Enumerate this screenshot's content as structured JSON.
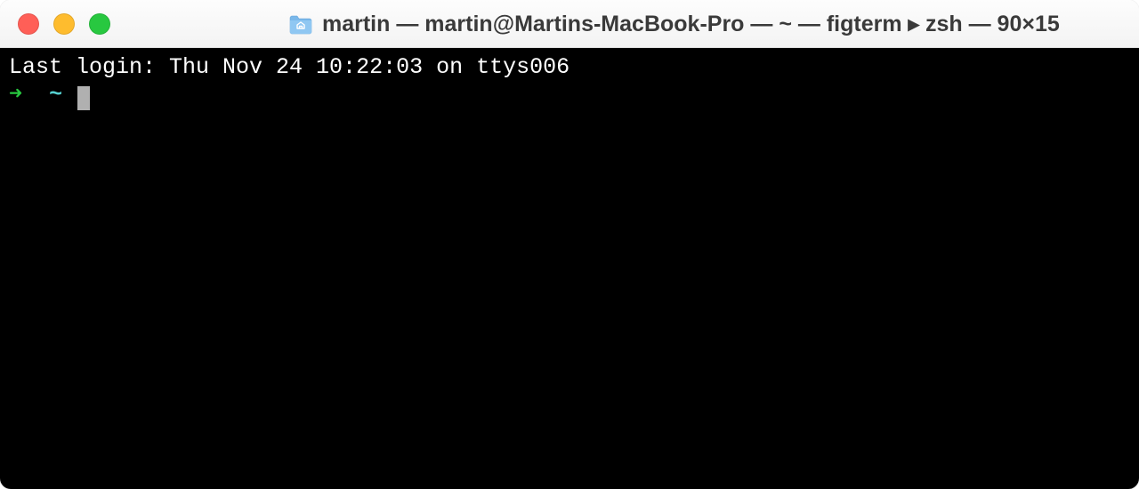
{
  "titlebar": {
    "title": "martin — martin@Martins-MacBook-Pro — ~ — figterm ▸ zsh — 90×15",
    "folder_icon": "home-folder-icon"
  },
  "terminal": {
    "last_login": "Last login: Thu Nov 24 10:22:03 on ttys006",
    "prompt": {
      "arrow": "➜",
      "cwd": "~"
    }
  },
  "colors": {
    "close": "#ff5f57",
    "minimize": "#febc2e",
    "zoom": "#28c840",
    "prompt_arrow": "#28c840",
    "prompt_cwd": "#56d1d1"
  }
}
